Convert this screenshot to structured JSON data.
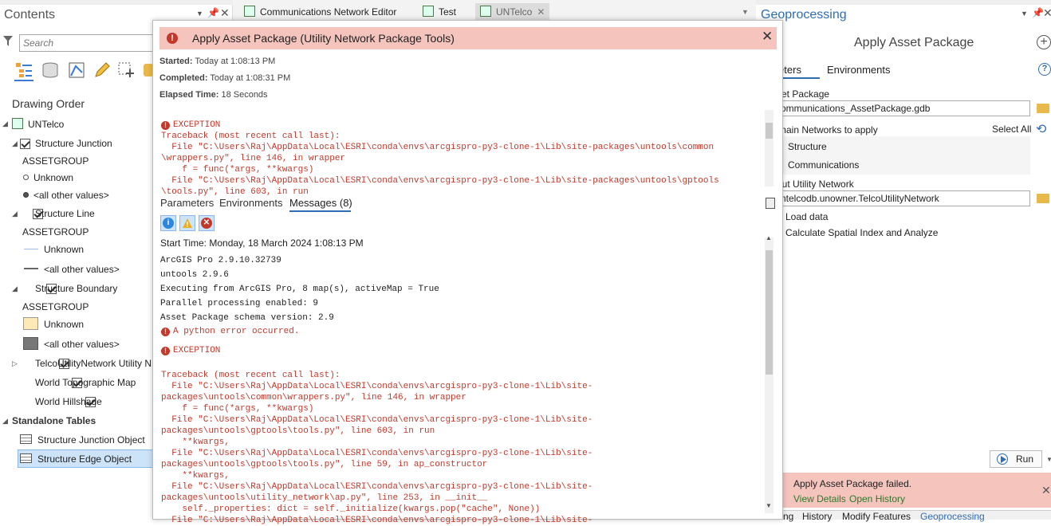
{
  "contents": {
    "title": "Contents",
    "search_placeholder": "Search",
    "drawing_order": "Drawing Order",
    "map_name": "UNTelco",
    "layers": [
      {
        "name": "Structure Junction",
        "group": "ASSETGROUP",
        "items": [
          "Unknown",
          "<all other values>"
        ]
      },
      {
        "name": "Structure Line",
        "group": "ASSETGROUP",
        "items": [
          "Unknown",
          "<all other values>"
        ]
      },
      {
        "name": "Structure Boundary",
        "group": "ASSETGROUP",
        "items": [
          "Unknown",
          "<all other values>"
        ]
      }
    ],
    "more_layers": [
      "TelcoUtilityNetwork Utility N",
      "World Topographic Map",
      "World Hillshade"
    ],
    "standalone_tables_label": "Standalone Tables",
    "tables": [
      "Structure Junction Object",
      "Structure Edge Object"
    ]
  },
  "tabs": [
    {
      "label": "Communications Network Editor"
    },
    {
      "label": "Test"
    },
    {
      "label": "UNTelco"
    }
  ],
  "dialog": {
    "title": "Apply Asset Package (Utility Network Package Tools)",
    "started_label": "Started:",
    "started_value": "Today at 1:08:13 PM",
    "completed_label": "Completed:",
    "completed_value": "Today at 1:08:31 PM",
    "elapsed_label": "Elapsed Time:",
    "elapsed_value": "18 Seconds",
    "top_log": [
      "EXCEPTION",
      "Traceback (most recent call last):",
      "  File \"C:\\Users\\Raj\\AppData\\Local\\ESRI\\conda\\envs\\arcgispro-py3-clone-1\\Lib\\site-packages\\untools\\common",
      "\\wrappers.py\", line 146, in wrapper",
      "    f = func(*args, **kwargs)",
      "  File \"C:\\Users\\Raj\\AppData\\Local\\ESRI\\conda\\envs\\arcgispro-py3-clone-1\\Lib\\site-packages\\untools\\gptools",
      "\\tools.py\", line 603, in run"
    ],
    "tabs": [
      "Parameters",
      "Environments",
      "Messages (8)"
    ],
    "messages": [
      "Start Time: Monday, 18 March 2024 1:08:13 PM",
      "ArcGIS Pro 2.9.10.32739",
      "untools 2.9.6",
      "Executing from ArcGIS Pro, 8 map(s), activeMap = True",
      "Parallel processing enabled: 9",
      "Asset Package schema version: 2.9"
    ],
    "python_error": "A python error occurred.",
    "exception_label": "EXCEPTION",
    "traceback": [
      "Traceback (most recent call last):",
      "  File \"C:\\Users\\Raj\\AppData\\Local\\ESRI\\conda\\envs\\arcgispro-py3-clone-1\\Lib\\site-",
      "packages\\untools\\common\\wrappers.py\", line 146, in wrapper",
      "    f = func(*args, **kwargs)",
      "  File \"C:\\Users\\Raj\\AppData\\Local\\ESRI\\conda\\envs\\arcgispro-py3-clone-1\\Lib\\site-",
      "packages\\untools\\gptools\\tools.py\", line 603, in run",
      "    **kwargs,",
      "  File \"C:\\Users\\Raj\\AppData\\Local\\ESRI\\conda\\envs\\arcgispro-py3-clone-1\\Lib\\site-",
      "packages\\untools\\gptools\\tools.py\", line 59, in ap_constructor",
      "    **kwargs,",
      "  File \"C:\\Users\\Raj\\AppData\\Local\\ESRI\\conda\\envs\\arcgispro-py3-clone-1\\Lib\\site-",
      "packages\\untools\\utility_network\\ap.py\", line 253, in __init__",
      "    self._properties: dict = self._initialize(kwargs.pop(\"cache\", None))",
      "  File \"C:\\Users\\Raj\\AppData\\Local\\ESRI\\conda\\envs\\arcgispro-py3-clone-1\\Lib\\site-"
    ]
  },
  "geo": {
    "pane_title": "Geoprocessing",
    "tool_title": "Apply Asset Package",
    "tab_parameters": "ameters",
    "tab_environments": "Environments",
    "asset_package_label": "set Package",
    "asset_package_value": "ommunications_AssetPackage.gdb",
    "domain_label": "main Networks to apply",
    "select_all": "Select All",
    "domains": [
      "Structure",
      "Communications"
    ],
    "target_label": "put Utility Network",
    "target_value": "ntelcodb.unowner.TelcoUtilityNetwork",
    "load_data": "Load data",
    "calc_index": "Calculate Spatial Index and Analyze",
    "run_label": "Run",
    "failed_msg": "Apply Asset Package failed.",
    "view_details": "View Details",
    "open_history": "Open History",
    "bottom_tabs": [
      "ng",
      "History",
      "Modify Features",
      "Geoprocessing"
    ]
  }
}
